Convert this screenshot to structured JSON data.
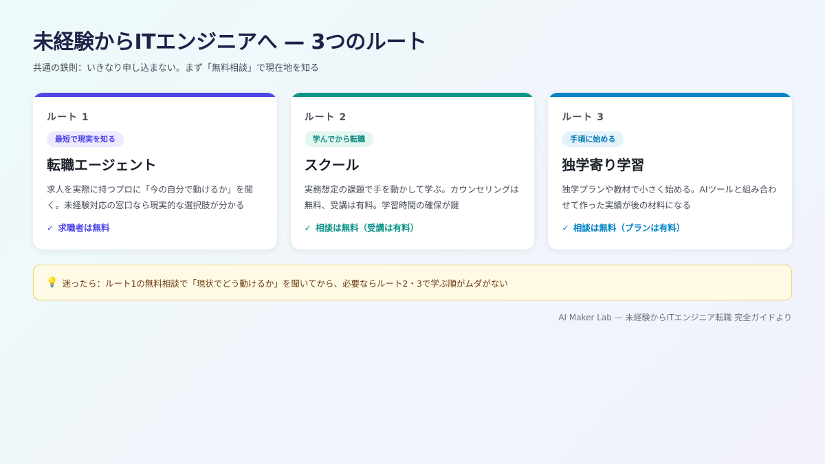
{
  "header": {
    "title": "未経験からITエンジニアへ — 3つのルート",
    "subtitle": "共通の鉄則：いきなり申し込まない。まず「無料相談」で現在地を知る"
  },
  "cards": [
    {
      "route": "ルート 1",
      "badge": "最短で現実を知る",
      "title": "転職エージェント",
      "description": "求人を実際に持つプロに「今の自分で動けるか」を聞く。未経験対応の窓口なら現実的な選択肢が分かる",
      "note": "求職者は無料",
      "accent": "#4f46e5",
      "badge_bg": "#eceafd",
      "badge_color": "#4f46e5"
    },
    {
      "route": "ルート 2",
      "badge": "学んでから転職",
      "title": "スクール",
      "description": "実務想定の課題で手を動かして学ぶ。カウンセリングは無料、受講は有料。学習時間の確保が鍵",
      "note": "相談は無料（受講は有料）",
      "accent": "#0d9488",
      "badge_bg": "#e3f6f2",
      "badge_color": "#0d8a7e"
    },
    {
      "route": "ルート 3",
      "badge": "手頃に始める",
      "title": "独学寄り学習",
      "description": "独学プランや教材で小さく始める。AIツールと組み合わせて作った実績が後の材料になる",
      "note": "相談は無料（プランは有料）",
      "accent": "#0284c7",
      "badge_bg": "#e4f3fb",
      "badge_color": "#0279b4"
    }
  ],
  "tip": {
    "icon": "lightbulb-icon",
    "text": "迷ったら：ルート1の無料相談で「現状でどう動けるか」を聞いてから、必要ならルート2・3で学ぶ順がムダがない"
  },
  "footer": {
    "credit": "AI Maker Lab — 未経験からITエンジニア転職 完全ガイドより"
  }
}
